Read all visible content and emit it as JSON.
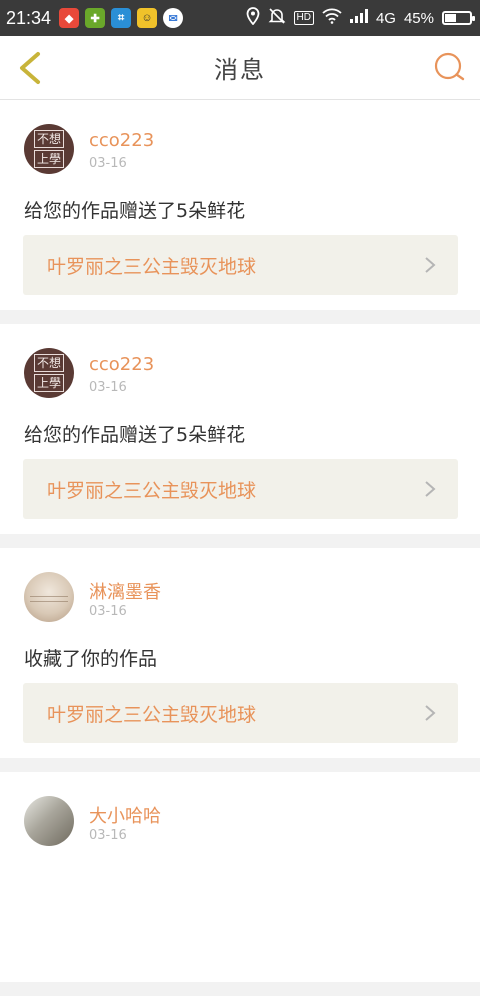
{
  "status_bar": {
    "time": "21:34",
    "network": "4G",
    "battery": "45%",
    "battery_level": 0.45,
    "hd_label": "HD"
  },
  "header": {
    "title": "消息"
  },
  "messages": [
    {
      "username": "cco223",
      "date": "03-16",
      "action": "给您的作品赠送了5朵鲜花",
      "work": "叶罗丽之三公主毁灭地球",
      "avatar_text": [
        "不想",
        "上學"
      ]
    },
    {
      "username": "cco223",
      "date": "03-16",
      "action": "给您的作品赠送了5朵鲜花",
      "work": "叶罗丽之三公主毁灭地球",
      "avatar_text": [
        "不想",
        "上學"
      ]
    },
    {
      "username": "淋漓墨香",
      "date": "03-16",
      "action": "收藏了你的作品",
      "work": "叶罗丽之三公主毁灭地球"
    },
    {
      "username": "大小哈哈",
      "date": "03-16"
    }
  ],
  "colors": {
    "accent": "#e8935a",
    "back_icon": "#c8b43a",
    "status_bar": "#3a3a3a"
  }
}
